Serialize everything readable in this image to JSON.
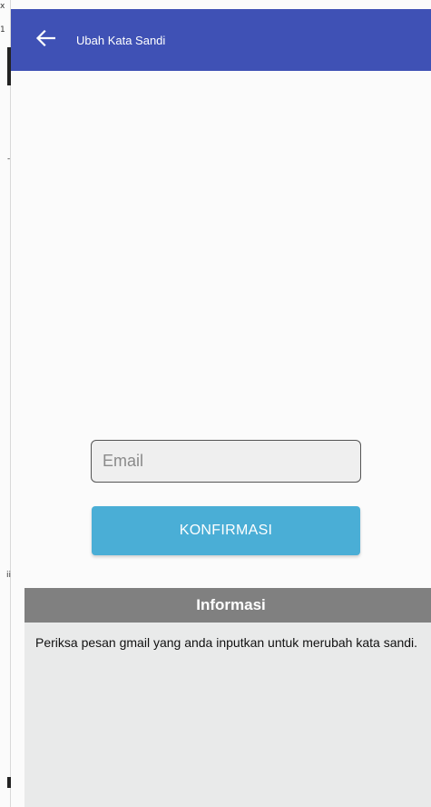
{
  "appbar": {
    "title": "Ubah Kata Sandi",
    "back_icon": "arrow-left-icon",
    "color": "#3f51b5"
  },
  "form": {
    "email_placeholder": "Email",
    "email_value": "",
    "confirm_label": "KONFIRMASI",
    "confirm_color": "#4aaed6"
  },
  "info": {
    "title": "Informasi",
    "message": "Periksa pesan gmail yang anda inputkan untuk merubah kata sandi.",
    "header_color": "#808080",
    "body_color": "#e9eaea"
  },
  "background_strip": {
    "stray_glyphs": [
      "x",
      "1",
      "-",
      "ii"
    ]
  }
}
